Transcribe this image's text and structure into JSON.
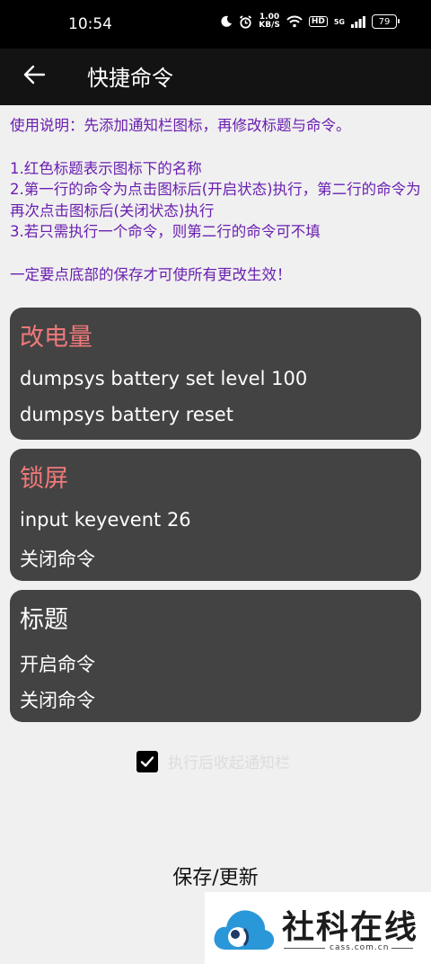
{
  "status_bar": {
    "time": "10:54",
    "net_speed_value": "1.00",
    "net_speed_unit": "KB/S",
    "hd": "HD",
    "signal": "5G",
    "battery": "79"
  },
  "app_bar": {
    "title": "快捷命令"
  },
  "instructions": {
    "usage": "使用说明：先添加通知栏图标，再修改标题与命令。",
    "point1": "1.红色标题表示图标下的名称",
    "point2": "2.第一行的命令为点击图标后(开启状态)执行，第二行的命令为再次点击图标后(关闭状态)执行",
    "point3": "3.若只需执行一个命令，则第二行的命令可不填",
    "warning": "一定要点底部的保存才可使所有更改生效！"
  },
  "cards": [
    {
      "title": "改电量",
      "command_on": "dumpsys battery set level 100",
      "command_off": "dumpsys battery reset"
    },
    {
      "title": "锁屏",
      "command_on": "input keyevent 26",
      "command_off": "关闭命令"
    },
    {
      "title": "标题",
      "command_on": "开启命令",
      "command_off": "关闭命令"
    }
  ],
  "collapse_option": {
    "label": "执行后收起通知栏",
    "checked": true
  },
  "save_button": "保存/更新",
  "watermark": {
    "text": "社科在线",
    "url": "cass.com.cn"
  },
  "colors": {
    "instruction_text": "#6a1fb0",
    "card_title_red": "#f07979",
    "card_background": "#434343"
  }
}
